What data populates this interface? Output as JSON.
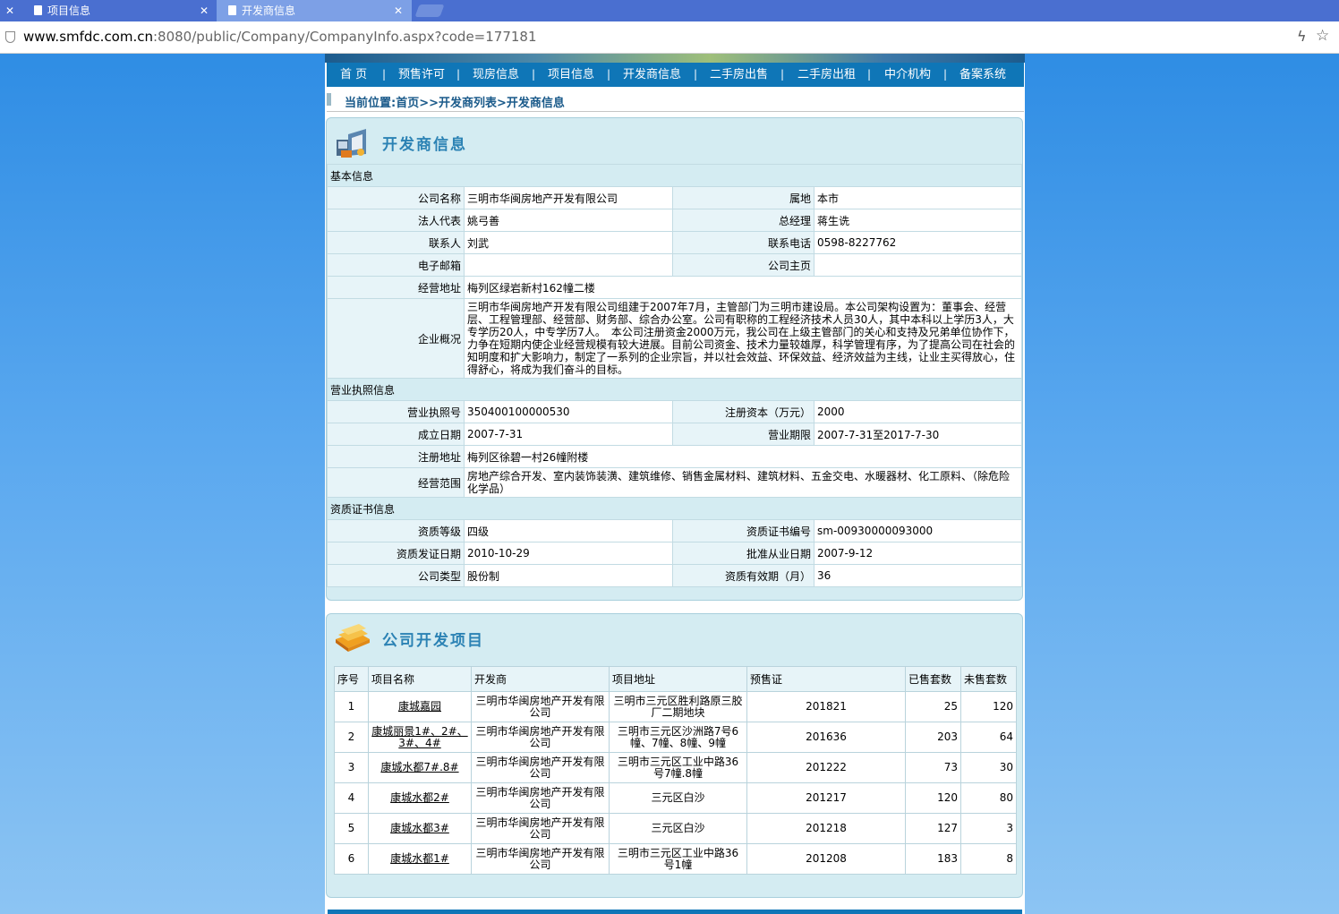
{
  "browser": {
    "tabs": [
      {
        "title": "项目信息",
        "active": false
      },
      {
        "title": "开发商信息",
        "active": true
      }
    ],
    "url_host": "www.smfdc.com.cn",
    "url_rest": ":8080/public/Company/CompanyInfo.aspx?code=177181"
  },
  "nav": {
    "items": [
      "首 页",
      "预售许可",
      "现房信息",
      "项目信息",
      "开发商信息",
      "二手房出售",
      "二手房出租",
      "中介机构",
      "备案系统"
    ],
    "separator": "|"
  },
  "breadcrumb": "当前位置:首页>>开发商列表>开发商信息",
  "developer": {
    "title": "开发商信息",
    "basic": {
      "section": "基本信息",
      "company_name_label": "公司名称",
      "company_name": "三明市华闽房地产开发有限公司",
      "location_label": "属地",
      "location": "本市",
      "legal_rep_label": "法人代表",
      "legal_rep": "姚弓善",
      "gm_label": "总经理",
      "gm": "蒋生诜",
      "contact_label": "联系人",
      "contact": "刘武",
      "phone_label": "联系电话",
      "phone": "0598-8227762",
      "email_label": "电子邮箱",
      "email": "",
      "homepage_label": "公司主页",
      "homepage": "",
      "address_label": "经营地址",
      "address": "梅列区绿岩新村162幢二楼",
      "overview_label": "企业概况",
      "overview": "三明市华闽房地产开发有限公司组建于2007年7月，主管部门为三明市建设局。本公司架构设置为：董事会、经营层、工程管理部、经营部、财务部、综合办公室。公司有职称的工程经济技术人员30人，其中本科以上学历3人，大专学历20人，中专学历7人。　本公司注册资金2000万元，我公司在上级主管部门的关心和支持及兄弟单位协作下，力争在短期内使企业经营规模有较大进展。目前公司资金、技术力量较雄厚，科学管理有序，为了提高公司在社会的知明度和扩大影响力，制定了一系列的企业宗旨，并以社会效益、环保效益、经济效益为主线，让业主买得放心，住得舒心，将成为我们奋斗的目标。"
    },
    "license": {
      "section": "营业执照信息",
      "license_no_label": "营业执照号",
      "license_no": "350400100000530",
      "capital_label": "注册资本（万元）",
      "capital": "2000",
      "founded_label": "成立日期",
      "founded": "2007-7-31",
      "term_label": "营业期限",
      "term": "2007-7-31至2017-7-30",
      "reg_address_label": "注册地址",
      "reg_address": "梅列区徐碧一村26幢附楼",
      "scope_label": "经营范围",
      "scope": "房地产综合开发、室内装饰装潢、建筑维修、销售金属材料、建筑材料、五金交电、水暖器材、化工原料、（除危险化学品）"
    },
    "qualification": {
      "section": "资质证书信息",
      "level_label": "资质等级",
      "level": "四级",
      "cert_no_label": "资质证书编号",
      "cert_no": "sm-00930000093000",
      "issue_date_label": "资质发证日期",
      "issue_date": "2010-10-29",
      "approve_date_label": "批准从业日期",
      "approve_date": "2007-9-12",
      "company_type_label": "公司类型",
      "company_type": "股份制",
      "validity_label": "资质有效期（月）",
      "validity": "36"
    }
  },
  "projects": {
    "title": "公司开发项目",
    "headers": [
      "序号",
      "项目名称",
      "开发商",
      "项目地址",
      "预售证",
      "已售套数",
      "未售套数"
    ],
    "rows": [
      {
        "no": "1",
        "name": "康城嘉园",
        "developer": "三明市华闽房地产开发有限公司",
        "address": "三明市三元区胜利路原三胶厂二期地块",
        "permit": "201821",
        "sold": "25",
        "unsold": "120"
      },
      {
        "no": "2",
        "name": "康城丽景1#、2#、3#、4#",
        "developer": "三明市华闽房地产开发有限公司",
        "address": "三明市三元区沙洲路7号6幢、7幢、8幢、9幢",
        "permit": "201636",
        "sold": "203",
        "unsold": "64"
      },
      {
        "no": "3",
        "name": "康城水都7#.8#",
        "developer": "三明市华闽房地产开发有限公司",
        "address": "三明市三元区工业中路36号7幢.8幢",
        "permit": "201222",
        "sold": "73",
        "unsold": "30"
      },
      {
        "no": "4",
        "name": "康城水都2#",
        "developer": "三明市华闽房地产开发有限公司",
        "address": "三元区白沙",
        "permit": "201217",
        "sold": "120",
        "unsold": "80"
      },
      {
        "no": "5",
        "name": "康城水都3#",
        "developer": "三明市华闽房地产开发有限公司",
        "address": "三元区白沙",
        "permit": "201218",
        "sold": "127",
        "unsold": "3"
      },
      {
        "no": "6",
        "name": "康城水都1#",
        "developer": "三明市华闽房地产开发有限公司",
        "address": "三明市三元区工业中路36号1幢",
        "permit": "201208",
        "sold": "183",
        "unsold": "8"
      }
    ]
  }
}
